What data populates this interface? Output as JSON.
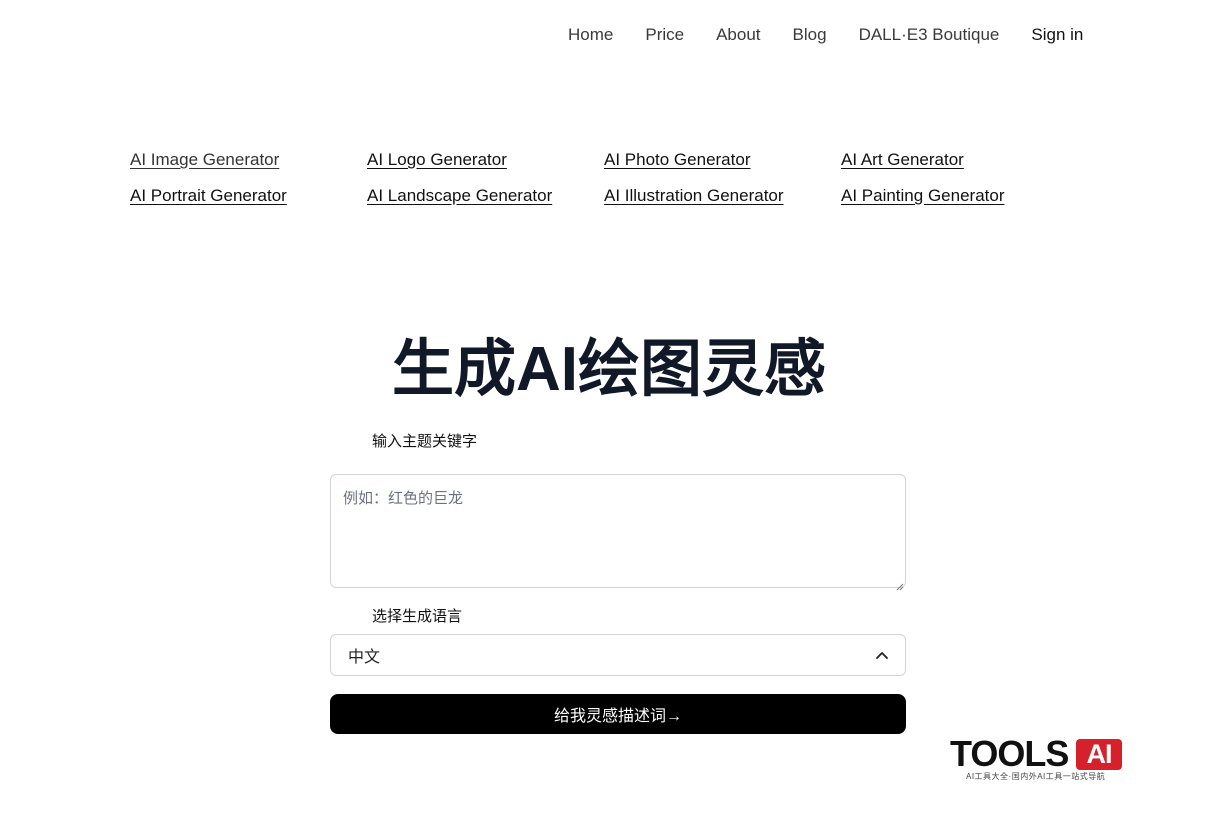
{
  "nav": {
    "links": [
      "Home",
      "Price",
      "About",
      "Blog",
      "DALL·E3 Boutique"
    ],
    "signin": "Sign in"
  },
  "generators": [
    "AI Image Generator",
    "AI Logo Generator",
    "AI Photo Generator",
    "AI Art Generator",
    "AI Portrait Generator",
    "AI Landscape Generator",
    "AI Illustration Generator",
    "AI Painting Generator"
  ],
  "hero": {
    "title": "生成AI绘图灵感"
  },
  "form": {
    "keyword_label": "输入主题关键字",
    "keyword_placeholder": "例如：红色的巨龙",
    "keyword_value": "",
    "language_label": "选择生成语言",
    "language_value": "中文",
    "submit_label": "给我灵感描述词→"
  },
  "watermark": {
    "word": "TOOLS",
    "badge": "AI",
    "tagline": "AI工具大全·国内外AI工具一站式导航",
    "badge_color": "#d6202c"
  }
}
